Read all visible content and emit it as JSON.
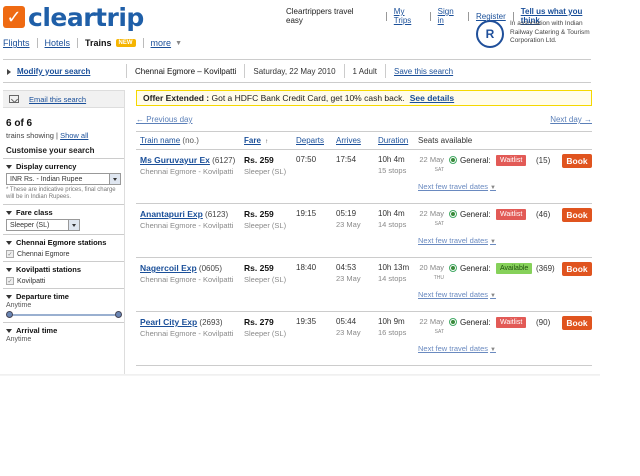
{
  "brand": {
    "logo_text": "cleartrip",
    "logo_mark": "✓"
  },
  "toplinks": {
    "tagline": "Cleartrippers travel easy",
    "my_trips": "My Trips",
    "sign_in": "Sign in",
    "register": "Register",
    "tell_us": "Tell us what you think"
  },
  "partner": {
    "mark": "R",
    "text": "In association with Indian Railway Catering & Tourism Corporation Ltd."
  },
  "nav": {
    "flights": "Flights",
    "hotels": "Hotels",
    "trains": "Trains",
    "new_badge": "NEW",
    "more": "more"
  },
  "summary": {
    "modify": "Modify your search",
    "route": "Chennai Egmore – Kovilpatti",
    "date": "Saturday, 22 May 2010",
    "pax": "1 Adult",
    "save": "Save this search"
  },
  "sidebar": {
    "email": "Email this search",
    "count": "6 of 6",
    "showing": "trains showing",
    "show_all": "Show all",
    "customise": "Customise your search",
    "currency_title": "Display currency",
    "currency_value": "INR Rs. - Indian Rupee",
    "currency_note": "* These are indicative prices, final charge will be in Indian Rupees.",
    "fare_title": "Fare class",
    "fare_value": "Sleeper (SL)",
    "from_title": "Chennai Egmore stations",
    "from_station": "Chennai Egmore",
    "to_title": "Kovilpatti stations",
    "to_station": "Kovilpatti",
    "dep_title": "Departure time",
    "dep_range": "Anytime",
    "arr_title": "Arrival time",
    "arr_range": "Anytime"
  },
  "promo": {
    "lead": "Offer Extended :",
    "text": "Got a HDFC Bank Credit Card, get 10% cash back.",
    "link": "See details"
  },
  "daynav": {
    "prev": "← Previous day",
    "next": "Next day →"
  },
  "columns": {
    "train_name": "Train name",
    "no": "(no.)",
    "fare": "Fare",
    "fare_sort": "↑",
    "departs": "Departs",
    "arrives": "Arrives",
    "duration": "Duration",
    "seats": "Seats available"
  },
  "common": {
    "book": "Book",
    "next_dates": "Next few travel dates",
    "class_label": "General:",
    "route_line": "Chennai Egmore - Kovilpatti",
    "fare_class": "Sleeper (SL)"
  },
  "trains": [
    {
      "name": "Ms Guruvayur Ex",
      "number": "(6127)",
      "fare": "Rs. 259",
      "departs": "07:50",
      "arrives": "17:54",
      "arrive_date": "",
      "duration": "10h 4m",
      "stops": "15 stops",
      "seat_date": "22 May",
      "seat_dow": "SAT",
      "status": "Waitlist",
      "status_type": "wait",
      "seat_count": "(15)"
    },
    {
      "name": "Anantapuri Exp",
      "number": "(6123)",
      "fare": "Rs. 259",
      "departs": "19:15",
      "arrives": "05:19",
      "arrive_date": "23 May",
      "duration": "10h 4m",
      "stops": "14 stops",
      "seat_date": "22 May",
      "seat_dow": "SAT",
      "status": "Waitlist",
      "status_type": "wait",
      "seat_count": "(46)"
    },
    {
      "name": "Nagercoil Exp",
      "number": "(0605)",
      "fare": "Rs. 259",
      "departs": "18:40",
      "arrives": "04:53",
      "arrive_date": "23 May",
      "duration": "10h 13m",
      "stops": "14 stops",
      "seat_date": "20 May",
      "seat_dow": "THU",
      "status": "Available",
      "status_type": "avail",
      "seat_count": "(369)"
    },
    {
      "name": "Pearl City Exp",
      "number": "(2693)",
      "fare": "Rs. 279",
      "departs": "19:35",
      "arrives": "05:44",
      "arrive_date": "23 May",
      "duration": "10h 9m",
      "stops": "16 stops",
      "seat_date": "22 May",
      "seat_dow": "SAT",
      "status": "Waitlist",
      "status_type": "wait",
      "seat_count": "(90)"
    }
  ],
  "colors": {
    "brand_orange": "#ef6a12",
    "brand_blue": "#1f5fa8",
    "book": "#e0541f",
    "waitlist": "#e25a56",
    "available": "#86d15a"
  }
}
